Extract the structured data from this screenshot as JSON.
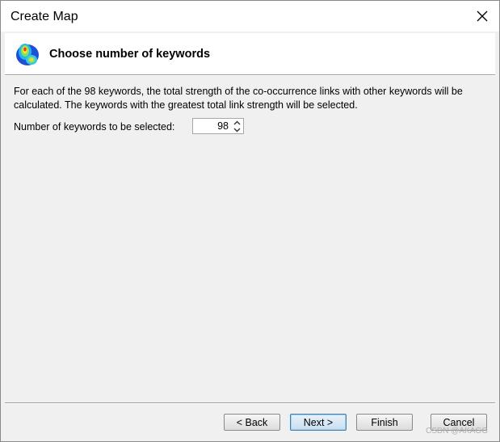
{
  "window": {
    "title": "Create Map",
    "close_icon": "close-icon"
  },
  "header": {
    "icon": "vosviewer-map-icon",
    "title": "Choose number of keywords"
  },
  "content": {
    "description": "For each of the 98 keywords, the total strength of the co-occurrence links with other keywords will be calculated. The keywords with the greatest total link strength will be selected.",
    "count_label": "Number of keywords to be selected:",
    "count_value": "98"
  },
  "buttons": {
    "back": "< Back",
    "next": "Next >",
    "finish": "Finish",
    "cancel": "Cancel"
  },
  "watermark": "CSDN @AKAGG",
  "colors": {
    "dialog_bg": "#f0f0f0",
    "default_button_border": "#3c7fb1"
  }
}
